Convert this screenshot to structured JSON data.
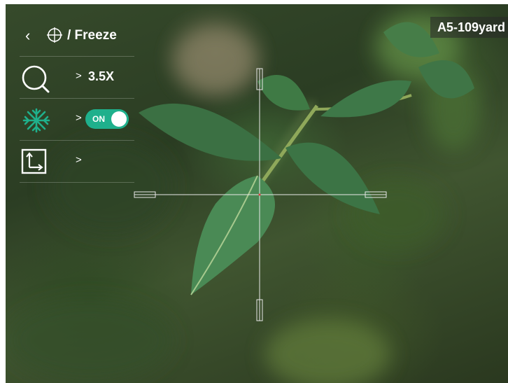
{
  "header": {
    "back_icon": "chevron-left-icon",
    "mode_icon": "crosshair-icon",
    "title": "/ Freeze"
  },
  "menu": {
    "zoom": {
      "icon": "magnifier-icon",
      "chevron": ">",
      "value": "3.5X"
    },
    "freeze": {
      "icon": "snowflake-icon",
      "chevron": ">",
      "toggle_label": "ON",
      "toggle_on": true
    },
    "picture_in_picture": {
      "icon": "pip-frame-icon",
      "chevron": ">"
    }
  },
  "distance": {
    "label": "A5-109yard"
  },
  "colors": {
    "accent": "#1fb08c",
    "text": "#ffffff",
    "reticle": "#e8e8e8"
  }
}
